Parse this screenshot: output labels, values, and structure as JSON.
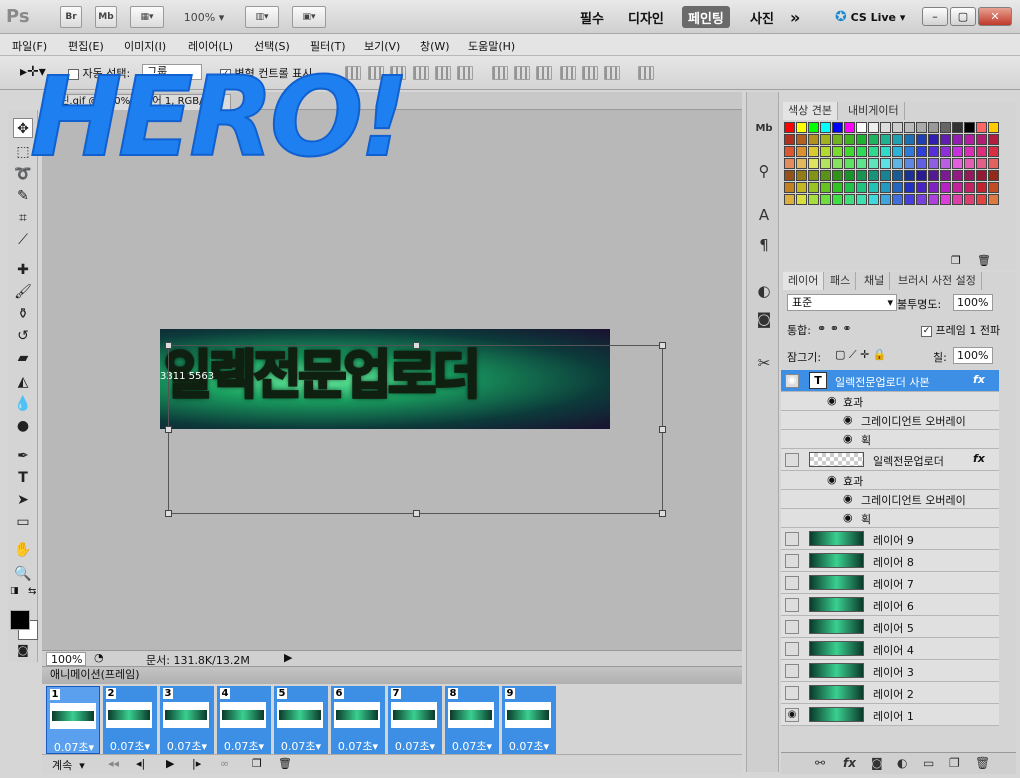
{
  "titlebar": {
    "logo": "Ps",
    "bridge": "Br",
    "minibridge": "Mb",
    "zoom": "100%",
    "workspaces": [
      "필수",
      "디자인",
      "페인팅",
      "사진"
    ],
    "more": "»",
    "cslive": "CS Live",
    "window_controls": [
      "–",
      "▢",
      "✕"
    ]
  },
  "menu": [
    "파일(F)",
    "편집(E)",
    "이미지(I)",
    "레이어(L)",
    "선택(S)",
    "필터(T)",
    "보기(V)",
    "창(W)",
    "도움말(H)"
  ],
  "options": {
    "auto_select": "자동 선택:",
    "group": "그룹",
    "show_transform": "변형 컨트롤 표시"
  },
  "document": {
    "tab_name": "콜린.gif @ 100%(레이어 1, RGB/8)",
    "banner_text": "일렉전문업로더",
    "banner_sub": "3311 5563",
    "hero_overlay": "HERO!"
  },
  "status": {
    "zoom": "100%",
    "doc_size": "문서: 131.8K/13.2M"
  },
  "animation": {
    "title": "애니메이션(프레임)",
    "frames": [
      {
        "num": "1",
        "delay": "0.07초"
      },
      {
        "num": "2",
        "delay": "0.07초"
      },
      {
        "num": "3",
        "delay": "0.07초"
      },
      {
        "num": "4",
        "delay": "0.07초"
      },
      {
        "num": "5",
        "delay": "0.07초"
      },
      {
        "num": "6",
        "delay": "0.07초"
      },
      {
        "num": "7",
        "delay": "0.07초"
      },
      {
        "num": "8",
        "delay": "0.07초"
      },
      {
        "num": "9",
        "delay": "0.07초"
      }
    ],
    "loop": "계속"
  },
  "swatches": {
    "tabs": [
      "색상 견본",
      "내비게이터"
    ]
  },
  "layers": {
    "tabs": [
      "레이어",
      "패스",
      "채널",
      "브러시 사전 설정"
    ],
    "blend": "표준",
    "opacity_label": "불투명도:",
    "opacity": "100%",
    "unify_label": "통합:",
    "propagate": "프레임 1 전파",
    "lock_label": "잠그기:",
    "fill_label": "칠:",
    "fill": "100%",
    "items": [
      {
        "name": "일렉전문업로더 사본",
        "type": "text"
      },
      {
        "name": "효과",
        "type": "effect"
      },
      {
        "name": "그레이디언트 오버레이",
        "type": "subeffect"
      },
      {
        "name": "획",
        "type": "subeffect"
      },
      {
        "name": "일렉전문업로더",
        "type": "layer"
      },
      {
        "name": "효과",
        "type": "effect"
      },
      {
        "name": "그레이디언트 오버레이",
        "type": "subeffect"
      },
      {
        "name": "획",
        "type": "subeffect"
      },
      {
        "name": "레이어 9",
        "type": "layer"
      },
      {
        "name": "레이어 8",
        "type": "layer"
      },
      {
        "name": "레이어 7",
        "type": "layer"
      },
      {
        "name": "레이어 6",
        "type": "layer"
      },
      {
        "name": "레이어 5",
        "type": "layer"
      },
      {
        "name": "레이어 4",
        "type": "layer"
      },
      {
        "name": "레이어 3",
        "type": "layer"
      },
      {
        "name": "레이어 2",
        "type": "layer"
      },
      {
        "name": "레이어 1",
        "type": "layer"
      }
    ],
    "fx": "fx"
  },
  "colors": {
    "accent": "#3d8fe6",
    "hero": "#1e7ff0"
  }
}
